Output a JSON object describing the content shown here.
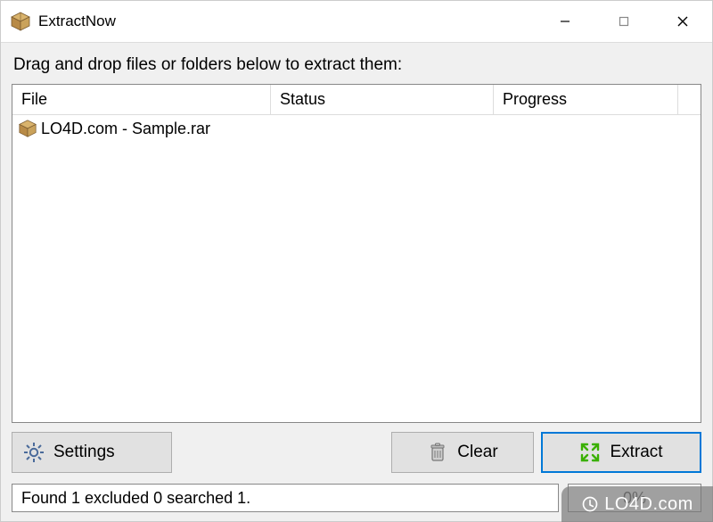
{
  "window": {
    "title": "ExtractNow"
  },
  "instruction": "Drag and drop files or folders below to extract them:",
  "columns": {
    "file": "File",
    "status": "Status",
    "progress": "Progress"
  },
  "rows": [
    {
      "file": "LO4D.com - Sample.rar",
      "status": "",
      "progress": ""
    }
  ],
  "buttons": {
    "settings": "Settings",
    "clear": "Clear",
    "extract": "Extract"
  },
  "status_text": "Found 1 excluded 0 searched 1.",
  "progress_text": "0%",
  "watermark": "LO4D.com",
  "icons": {
    "app": "box-icon",
    "file": "box-icon",
    "settings": "gear-icon",
    "clear": "trash-icon",
    "extract": "expand-icon"
  }
}
